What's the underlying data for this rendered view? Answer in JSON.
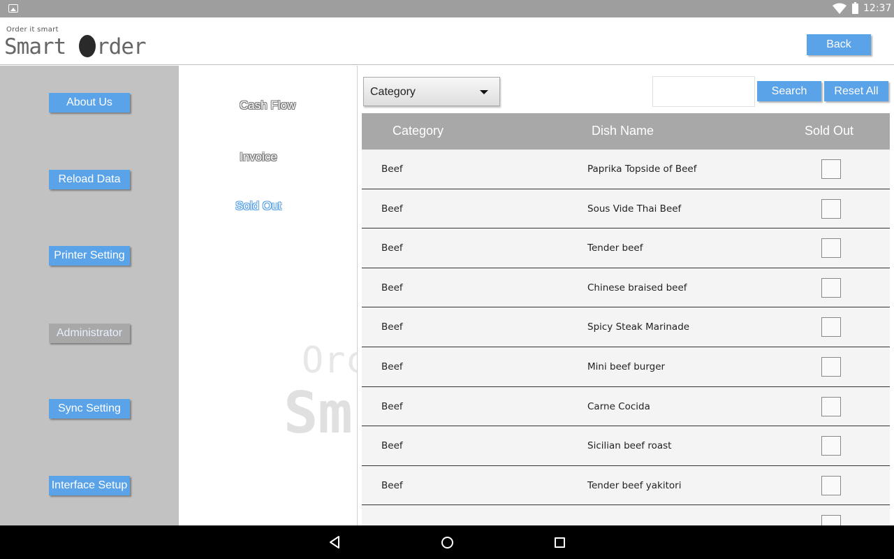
{
  "status_bar": {
    "time": "12:37"
  },
  "header": {
    "logo_tagline": "Order it smart",
    "logo_word_1": "Smart",
    "logo_word_2": "rder",
    "back_label": "Back"
  },
  "sidebar": {
    "items": [
      {
        "label": "About Us"
      },
      {
        "label": "Reload Data"
      },
      {
        "label": "Printer Setting"
      },
      {
        "label": "Administrator"
      },
      {
        "label": "Sync Setting"
      },
      {
        "label": "Interface Setup"
      }
    ],
    "active_index": 3
  },
  "submenu": {
    "items": [
      {
        "label": "Cash Flow"
      },
      {
        "label": "Invoice"
      },
      {
        "label": "Sold Out"
      }
    ],
    "active_index": 2
  },
  "filter": {
    "category_selected": "Category",
    "search_value": "",
    "search_label": "Search",
    "reset_label": "Reset All"
  },
  "table": {
    "headers": [
      "Category",
      "Dish Name",
      "Sold Out"
    ],
    "rows": [
      {
        "category": "Beef",
        "dish": "Paprika Topside of Beef",
        "sold_out": false
      },
      {
        "category": "Beef",
        "dish": "Sous Vide Thai Beef",
        "sold_out": false
      },
      {
        "category": "Beef",
        "dish": "Tender beef",
        "sold_out": false
      },
      {
        "category": "Beef",
        "dish": "Chinese braised beef",
        "sold_out": false
      },
      {
        "category": "Beef",
        "dish": "Spicy Steak Marinade",
        "sold_out": false
      },
      {
        "category": "Beef",
        "dish": "Mini beef burger",
        "sold_out": false
      },
      {
        "category": "Beef",
        "dish": "Carne Cocida",
        "sold_out": false
      },
      {
        "category": "Beef",
        "dish": "Sicilian beef roast",
        "sold_out": false
      },
      {
        "category": "Beef",
        "dish": "Tender beef yakitori",
        "sold_out": false
      }
    ]
  },
  "colors": {
    "accent": "#5aa3e8",
    "sidebar_bg": "#c2c2c2",
    "table_header_bg": "#a8a8a8"
  }
}
